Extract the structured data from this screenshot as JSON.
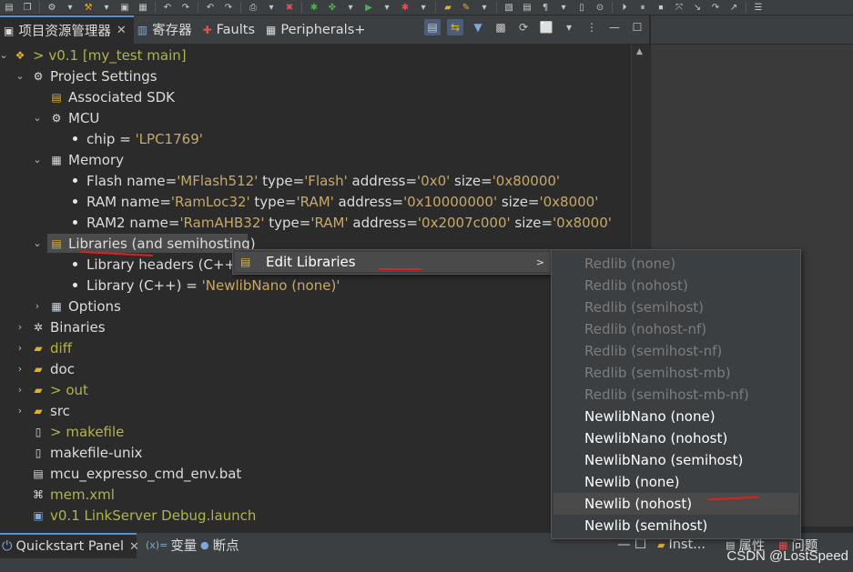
{
  "toolbar": {
    "icons": [
      "save-all-icon",
      "copy-icon",
      "gear-icon",
      "hammer-icon",
      "build-icon",
      "memory-icon",
      "undo-icon",
      "redo-icon",
      "undo2-icon",
      "redo2-icon",
      "print-icon",
      "debug-bug-icon",
      "debug-icon",
      "run-icon",
      "stop-icon",
      "folder-open-icon",
      "edit-icon",
      "notes-icon",
      "doc-icon",
      "pilcrow-icon",
      "doc2-icon",
      "link-icon",
      "play-icon",
      "pause-icon",
      "stop2-icon",
      "step-into-icon",
      "step-over-icon",
      "step-return-icon",
      "menu-icon"
    ]
  },
  "explorer": {
    "tabs": [
      {
        "label": "项目资源管理器",
        "active": true
      },
      {
        "label": "寄存器",
        "active": false
      },
      {
        "label": "Faults",
        "active": false
      },
      {
        "label": "Peripherals+",
        "active": false
      }
    ],
    "close_glyph": "✕",
    "tree": {
      "project": {
        "prefix": ">",
        "label": "v0.1 [my_test main]"
      },
      "project_settings": "Project Settings",
      "associated_sdk": "Associated SDK",
      "mcu": "MCU",
      "chip": {
        "label": "chip = ",
        "value": "'LPC1769'"
      },
      "memory": "Memory",
      "flash": {
        "l1": "Flash name=",
        "v1": "'MFlash512'",
        "l2": " type=",
        "v2": "'Flash'",
        "l3": " address=",
        "v3": "'0x0'",
        "l4": " size=",
        "v4": "'0x80000'"
      },
      "ram": {
        "l1": "RAM name=",
        "v1": "'RamLoc32'",
        "l2": " type=",
        "v2": "'RAM'",
        "l3": " address=",
        "v3": "'0x10000000'",
        "l4": " size=",
        "v4": "'0x8000'"
      },
      "ram2": {
        "l1": "RAM2 name=",
        "v1": "'RamAHB32'",
        "l2": " type=",
        "v2": "'RAM'",
        "l3": " address=",
        "v3": "'0x2007c000'",
        "l4": " size=",
        "v4": "'0x8000'"
      },
      "libraries": "Libraries (and semihosting)",
      "library_headers": "Library headers (C++)",
      "library_cpp": {
        "label": "Library (C++) = ",
        "value": "'NewlibNano (none)'"
      },
      "options": "Options",
      "binaries": "Binaries",
      "diff": "diff",
      "doc": "doc",
      "out": {
        "prefix": ">",
        "label": "out"
      },
      "src": "src",
      "makefile": {
        "prefix": ">",
        "label": "makefile"
      },
      "makefile_unix": "makefile-unix",
      "cmd_env": "mcu_expresso_cmd_env.bat",
      "mem_xml": "mem.xml",
      "launch": "v0.1 LinkServer Debug.launch"
    }
  },
  "context_menu": {
    "edit_libraries": "Edit Libraries",
    "submenu_arrow": ">"
  },
  "submenu": {
    "items": [
      {
        "label": "Redlib (none)",
        "enabled": false
      },
      {
        "label": "Redlib (nohost)",
        "enabled": false
      },
      {
        "label": "Redlib (semihost)",
        "enabled": false
      },
      {
        "label": "Redlib (nohost-nf)",
        "enabled": false
      },
      {
        "label": "Redlib (semihost-nf)",
        "enabled": false
      },
      {
        "label": "Redlib (semihost-mb)",
        "enabled": false
      },
      {
        "label": "Redlib (semihost-mb-nf)",
        "enabled": false
      },
      {
        "label": "NewlibNano (none)",
        "enabled": true
      },
      {
        "label": "NewlibNano (nohost)",
        "enabled": true
      },
      {
        "label": "NewlibNano (semihost)",
        "enabled": true
      },
      {
        "label": "Newlib (none)",
        "enabled": true
      },
      {
        "label": "Newlib (nohost)",
        "enabled": true,
        "hovered": true
      },
      {
        "label": "Newlib (semihost)",
        "enabled": true
      }
    ]
  },
  "bottom": {
    "tabs": [
      {
        "label": "Quickstart Panel",
        "active": true
      },
      {
        "label": "变量",
        "active": false
      },
      {
        "label": "断点",
        "active": false
      }
    ],
    "right_tabs": [
      {
        "label": "Inst..."
      },
      {
        "label": "属性"
      },
      {
        "label": "问题"
      }
    ]
  },
  "watermark": "CSDN @LostSpeed",
  "colors": {
    "background": "#2b2b2b",
    "value_text": "#c8a86a",
    "olive_text": "#b3b34d",
    "disabled_text": "#7c7c7c",
    "annotation": "#e02020",
    "accent": "#5a8fd8"
  }
}
